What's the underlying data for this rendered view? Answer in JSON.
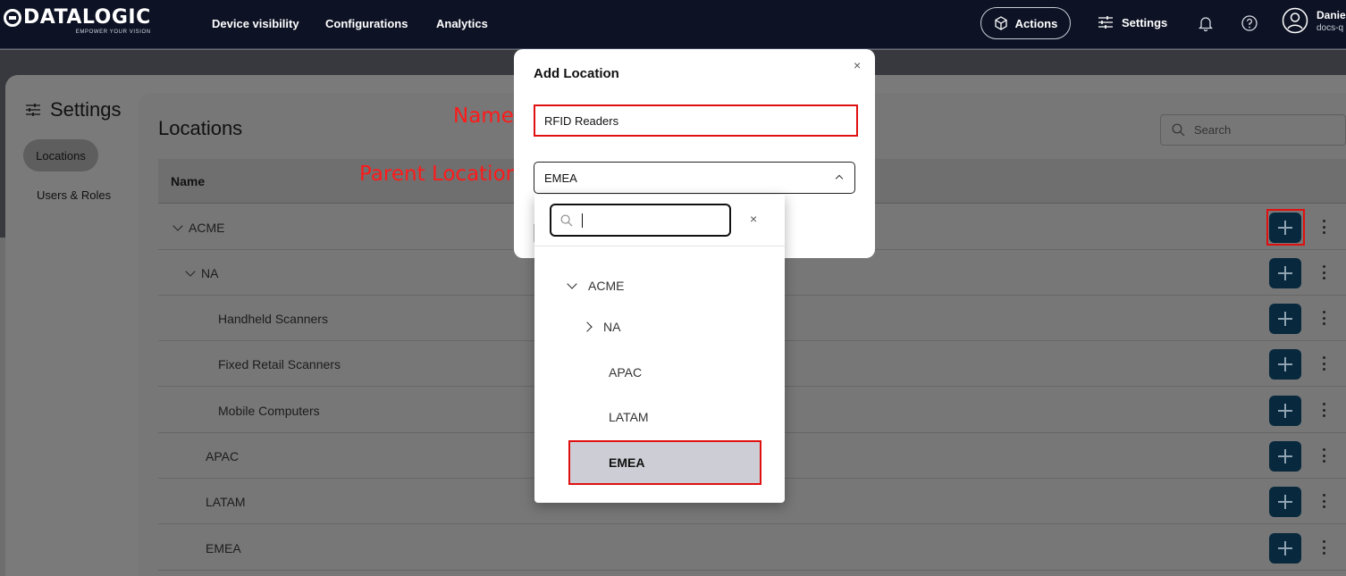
{
  "header": {
    "logo_text": "DATALOGIC",
    "logo_tagline": "EMPOWER YOUR VISION",
    "nav": [
      "Device visibility",
      "Configurations",
      "Analytics"
    ],
    "actions_label": "Actions",
    "settings_label": "Settings",
    "user_name": "Daniel",
    "user_org": "docs-q"
  },
  "sidebar": {
    "title": "Settings",
    "items": [
      {
        "label": "Locations",
        "active": true
      },
      {
        "label": "Users & Roles",
        "active": false
      }
    ]
  },
  "main": {
    "title": "Locations",
    "search_placeholder": "Search",
    "column_name": "Name",
    "rows": [
      {
        "label": "ACME",
        "expand": "down"
      },
      {
        "label": "NA",
        "expand": "down"
      },
      {
        "label": "Handheld Scanners",
        "expand": ""
      },
      {
        "label": "Fixed Retail Scanners",
        "expand": ""
      },
      {
        "label": "Mobile Computers",
        "expand": ""
      },
      {
        "label": "APAC",
        "expand": ""
      },
      {
        "label": "LATAM",
        "expand": ""
      },
      {
        "label": "EMEA",
        "expand": ""
      }
    ]
  },
  "annotations": {
    "name": "Name",
    "parent": "Parent Location"
  },
  "modal": {
    "title": "Add Location",
    "close": "×",
    "name_value": "RFID Readers",
    "parent_value": "EMEA",
    "dropdown": {
      "search_value": "",
      "clear": "×",
      "options": [
        {
          "label": "ACME",
          "expand": "down"
        },
        {
          "label": "NA",
          "expand": "right"
        },
        {
          "label": "APAC",
          "expand": ""
        },
        {
          "label": "LATAM",
          "expand": ""
        },
        {
          "label": "EMEA",
          "expand": "",
          "selected": true
        }
      ]
    }
  },
  "colors": {
    "topbar": "#0d1224",
    "add_button": "#07283d",
    "highlight": "#e01010",
    "selected_option": "#cdcdd5"
  }
}
